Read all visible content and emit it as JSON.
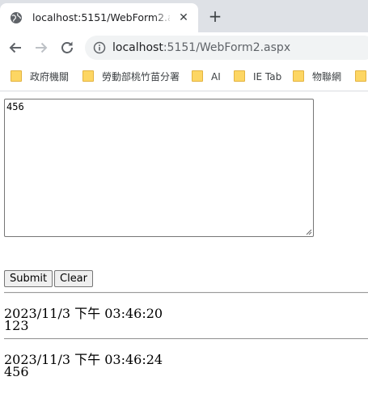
{
  "browser": {
    "tab": {
      "title": "localhost:5151/WebForm2.aspx"
    },
    "address": {
      "host": "localhost",
      "rest": ":5151/WebForm2.aspx"
    },
    "bookmarks": [
      "政府機關",
      "勞動部桃竹苗分署",
      "AI",
      "IE Tab",
      "物聯網"
    ]
  },
  "form": {
    "textarea_value": "456",
    "submit_label": "Submit",
    "clear_label": "Clear"
  },
  "entries": [
    {
      "timestamp": "2023/11/3 下午 03:46:20",
      "text": "123"
    },
    {
      "timestamp": "2023/11/3 下午 03:46:24",
      "text": "456"
    }
  ],
  "colors": {
    "tabstrip": "#dee1e6",
    "omnibox": "#f1f3f4",
    "folder": "#fdd663"
  },
  "icons": [
    "globe-icon",
    "close-icon",
    "plus-icon",
    "back-arrow-icon",
    "forward-arrow-icon",
    "reload-icon",
    "info-icon",
    "folder-icon"
  ]
}
